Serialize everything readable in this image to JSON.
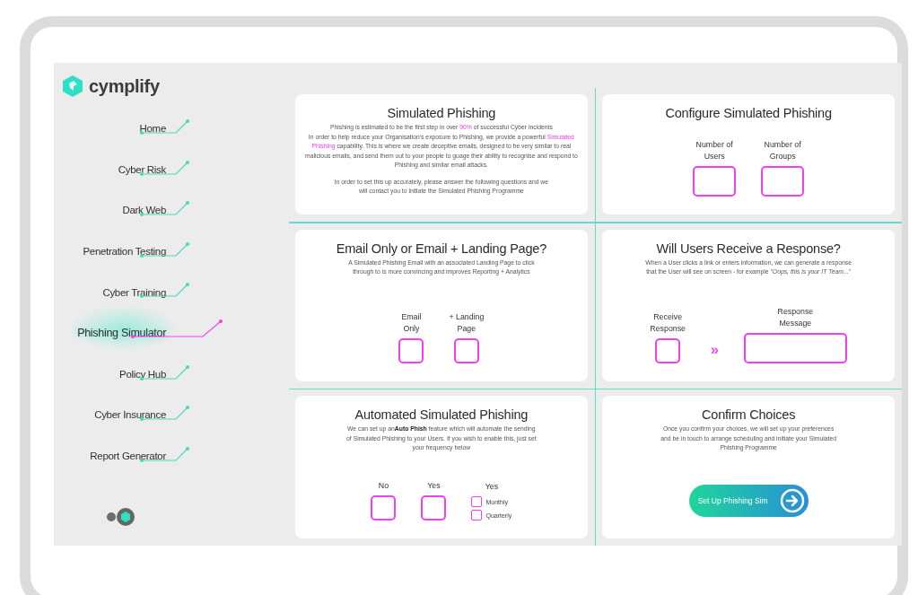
{
  "brand": {
    "name": "cymplify"
  },
  "nav": [
    {
      "label": "Home",
      "selected": false
    },
    {
      "label": "Cyber Risk",
      "selected": false
    },
    {
      "label": "Dark Web",
      "selected": false
    },
    {
      "label": "Penetration Testing",
      "selected": false
    },
    {
      "label": "Cyber Training",
      "selected": false
    },
    {
      "label": "Phishing Simulator",
      "selected": true
    },
    {
      "label": "Policy Hub",
      "selected": false
    },
    {
      "label": "Cyber Insurance",
      "selected": false
    },
    {
      "label": "Report Generator",
      "selected": false
    }
  ],
  "cards": [
    {
      "kind": "intro",
      "title": "Simulated Phishing",
      "paragraphs": [
        "Phishing is estimated to be the first step in over **90%** of successful Cyber incidents\nIn order to help reduce your Organisation's exposure to Phishing, we provide a powerful **Simulated Phishing** capability. This is where we create deceptive emails, designed to be very similar to real malicious emails, and send them out to your people to guage their ability to recognise and respond to Phishing and similar email attacks.",
        "In order to set this up accurately, please answer the following questions and we\nwill contact you to initiate the Simulated Phishing Programme"
      ]
    },
    {
      "kind": "count_fields",
      "title": "Configure Simulated Phishing",
      "fields": [
        {
          "label": "Number of\nUsers"
        },
        {
          "label": "Number of\nGroups"
        }
      ]
    },
    {
      "kind": "choices",
      "title": "Email Only or Email + Landing Page?",
      "description": "A Simulated Phishing Email with an associated Landing Page to click\nthrough to is more convincing and improves Reporting + Analytics",
      "options": [
        {
          "kind": "box",
          "label": "Email\nOnly",
          "checked": false
        },
        {
          "kind": "box",
          "label": "+ Landing\nPage",
          "checked": false
        }
      ]
    },
    {
      "kind": "choices",
      "title": "Will Users Receive a Response?",
      "description": "When a User clicks a link or enters information, we can generate a response\nthat the User will see on screen - for example *\"Oops, this is your IT Team...\"*",
      "options": [
        {
          "kind": "box",
          "label": "Receive\nResponse",
          "checked": false
        },
        {
          "kind": "arrow",
          "text": "»"
        },
        {
          "kind": "field",
          "label": "Response\nMessage"
        }
      ]
    },
    {
      "kind": "choices",
      "title": "Automated Simulated Phishing",
      "description": "We can set up an**Auto Phish** feature which will automate the sending\nof Simulated Phishing to your Users. If you wish to enable this, just set\nyour frequency below",
      "options": [
        {
          "kind": "box",
          "label": "No",
          "checked": false
        },
        {
          "kind": "box",
          "label": "Yes",
          "checked": false
        },
        {
          "kind": "list",
          "label": "Yes",
          "choices": [
            {
              "label": "Monthly",
              "checked": false
            },
            {
              "label": "Quarterly",
              "checked": false
            }
          ]
        }
      ]
    },
    {
      "kind": "confirm",
      "title": "Confirm Choices",
      "description": "Once you confirm your choices, we will set up your preferences\nand be in touch to arrange scheduling and initiate your Simulated\nPhishing Programme",
      "button": "Set Up Phishing Sim"
    }
  ]
}
